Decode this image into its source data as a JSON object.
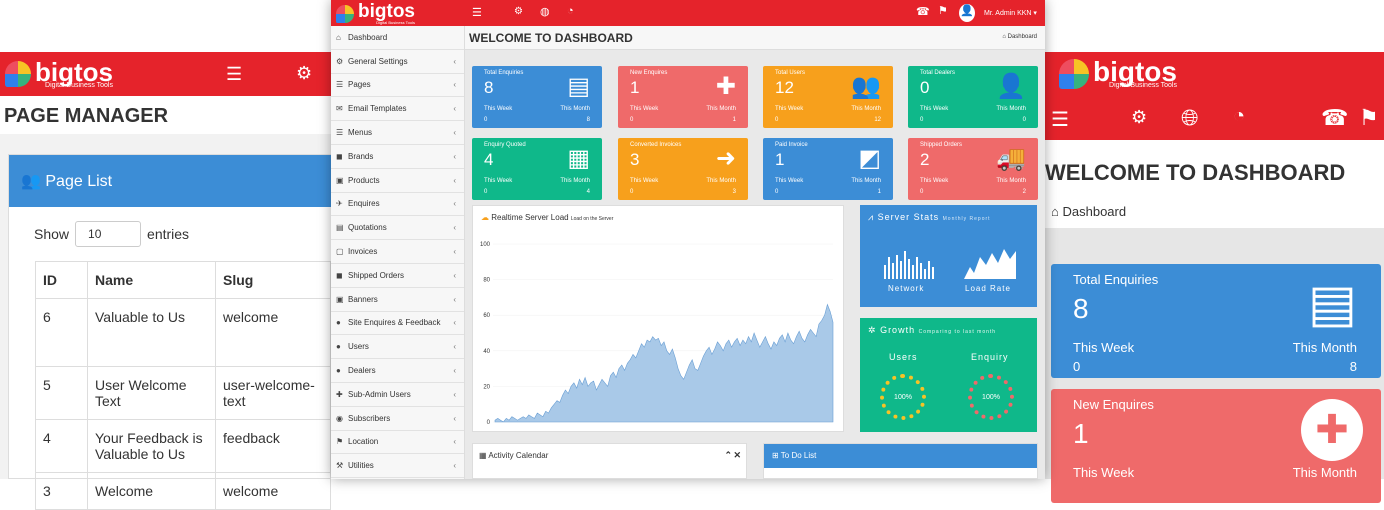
{
  "brand": {
    "name": "bigtos",
    "tagline": "Digital Business Tools"
  },
  "left": {
    "title": "PAGE MANAGER",
    "panel_title": "Page List",
    "show_label": "Show",
    "entries_value": "10",
    "entries_label": "entries",
    "columns": [
      "ID",
      "Name",
      "Slug"
    ],
    "rows": [
      {
        "id": "6",
        "name": "Valuable to Us",
        "slug": "welcome"
      },
      {
        "id": "5",
        "name": "User Welcome Text",
        "slug": "user-welcome-text"
      },
      {
        "id": "4",
        "name": "Your Feedback is Valuable to Us",
        "slug": "feedback"
      },
      {
        "id": "3",
        "name": "Welcome",
        "slug": "welcome"
      }
    ]
  },
  "center": {
    "user": "Mr. Admin KKN",
    "page_title": "WELCOME TO DASHBOARD",
    "breadcrumb": "Dashboard",
    "menu": [
      "Dashboard",
      "General Settings",
      "Pages",
      "Email Templates",
      "Menus",
      "Brands",
      "Products",
      "Enquires",
      "Quotations",
      "Invoices",
      "Shipped Orders",
      "Banners",
      "Site Enquires & Feedback",
      "Users",
      "Dealers",
      "Sub-Admin Users",
      "Subscribers",
      "Location",
      "Utilities"
    ],
    "tiles": [
      {
        "title": "Total Enquiries",
        "value": "8",
        "week": "This Week",
        "month": "This Month",
        "wv": "0",
        "mv": "8",
        "color": "blue",
        "icon": "notebook-icon",
        "glyph": "▤"
      },
      {
        "title": "New Enquires",
        "value": "1",
        "week": "This Week",
        "month": "This Month",
        "wv": "0",
        "mv": "1",
        "color": "red",
        "icon": "plus-circle-icon",
        "glyph": "✚"
      },
      {
        "title": "Total Users",
        "value": "12",
        "week": "This Week",
        "month": "This Month",
        "wv": "0",
        "mv": "12",
        "color": "orange",
        "icon": "users-icon",
        "glyph": "👥"
      },
      {
        "title": "Total Dealers",
        "value": "0",
        "week": "This Week",
        "month": "This Month",
        "wv": "0",
        "mv": "0",
        "color": "green",
        "icon": "user-icon",
        "glyph": "👤"
      },
      {
        "title": "Enquiry Quoted",
        "value": "4",
        "week": "This Week",
        "month": "This Month",
        "wv": "0",
        "mv": "4",
        "color": "green",
        "icon": "calculator-icon",
        "glyph": "▦"
      },
      {
        "title": "Converted Invoices",
        "value": "3",
        "week": "This Week",
        "month": "This Month",
        "wv": "0",
        "mv": "3",
        "color": "orange",
        "icon": "file-export-icon",
        "glyph": "➜"
      },
      {
        "title": "Paid Invoice",
        "value": "1",
        "week": "This Week",
        "month": "This Month",
        "wv": "0",
        "mv": "1",
        "color": "blue",
        "icon": "qr-icon",
        "glyph": "◩"
      },
      {
        "title": "Shipped Orders",
        "value": "2",
        "week": "This Week",
        "month": "This Month",
        "wv": "0",
        "mv": "2",
        "color": "red",
        "icon": "truck-icon",
        "glyph": "🚚"
      }
    ],
    "server_load": {
      "title": "Realtime Server Load",
      "subtitle": "Load on the Server"
    },
    "server_stats": {
      "title": "Server Stats",
      "subtitle": "Monthly Report",
      "network": "Network",
      "load_rate": "Load Rate"
    },
    "growth": {
      "title": "Growth",
      "subtitle": "Comparing to last month",
      "users": "Users",
      "enquiry": "Enquiry",
      "users_pct": "100%",
      "enquiry_pct": "100%"
    },
    "activity": "Activity Calendar",
    "todo": "To Do List"
  },
  "chart_data": {
    "type": "area",
    "title": "Realtime Server Load",
    "subtitle": "Load on the Server",
    "ylim": [
      0,
      100
    ],
    "yticks": [
      0,
      20,
      40,
      60,
      80,
      100
    ],
    "values": [
      1,
      2,
      1,
      0,
      2,
      1,
      3,
      2,
      1,
      2,
      3,
      2,
      4,
      3,
      2,
      5,
      4,
      3,
      6,
      5,
      8,
      10,
      12,
      11,
      15,
      18,
      16,
      20,
      22,
      19,
      24,
      21,
      25,
      20,
      22,
      23,
      18,
      21,
      24,
      22,
      20,
      26,
      28,
      25,
      30,
      32,
      29,
      33,
      35,
      38,
      36,
      40,
      44,
      42,
      46,
      45,
      48,
      46,
      47,
      43,
      45,
      40,
      38,
      41,
      36,
      30,
      26,
      24,
      28,
      32,
      35,
      30,
      29,
      33,
      37,
      40,
      42,
      38,
      41,
      45,
      43,
      40,
      44,
      46,
      42,
      45,
      47,
      43,
      46,
      44,
      48,
      45,
      50,
      46,
      42,
      45,
      48,
      44,
      41,
      45,
      43,
      47,
      49,
      45,
      50,
      46,
      44,
      48,
      51,
      47,
      45,
      49,
      52,
      50,
      48,
      55,
      57,
      60,
      66,
      62,
      56
    ]
  },
  "right": {
    "page_title": "WELCOME TO DASHBOARD",
    "breadcrumb": "Dashboard",
    "tile1": {
      "title": "Total Enquiries",
      "value": "8",
      "week": "This Week",
      "month": "This Month",
      "wv": "0",
      "mv": "8"
    },
    "tile2": {
      "title": "New Enquires",
      "value": "1",
      "week": "This Week",
      "month": "This Month"
    }
  }
}
